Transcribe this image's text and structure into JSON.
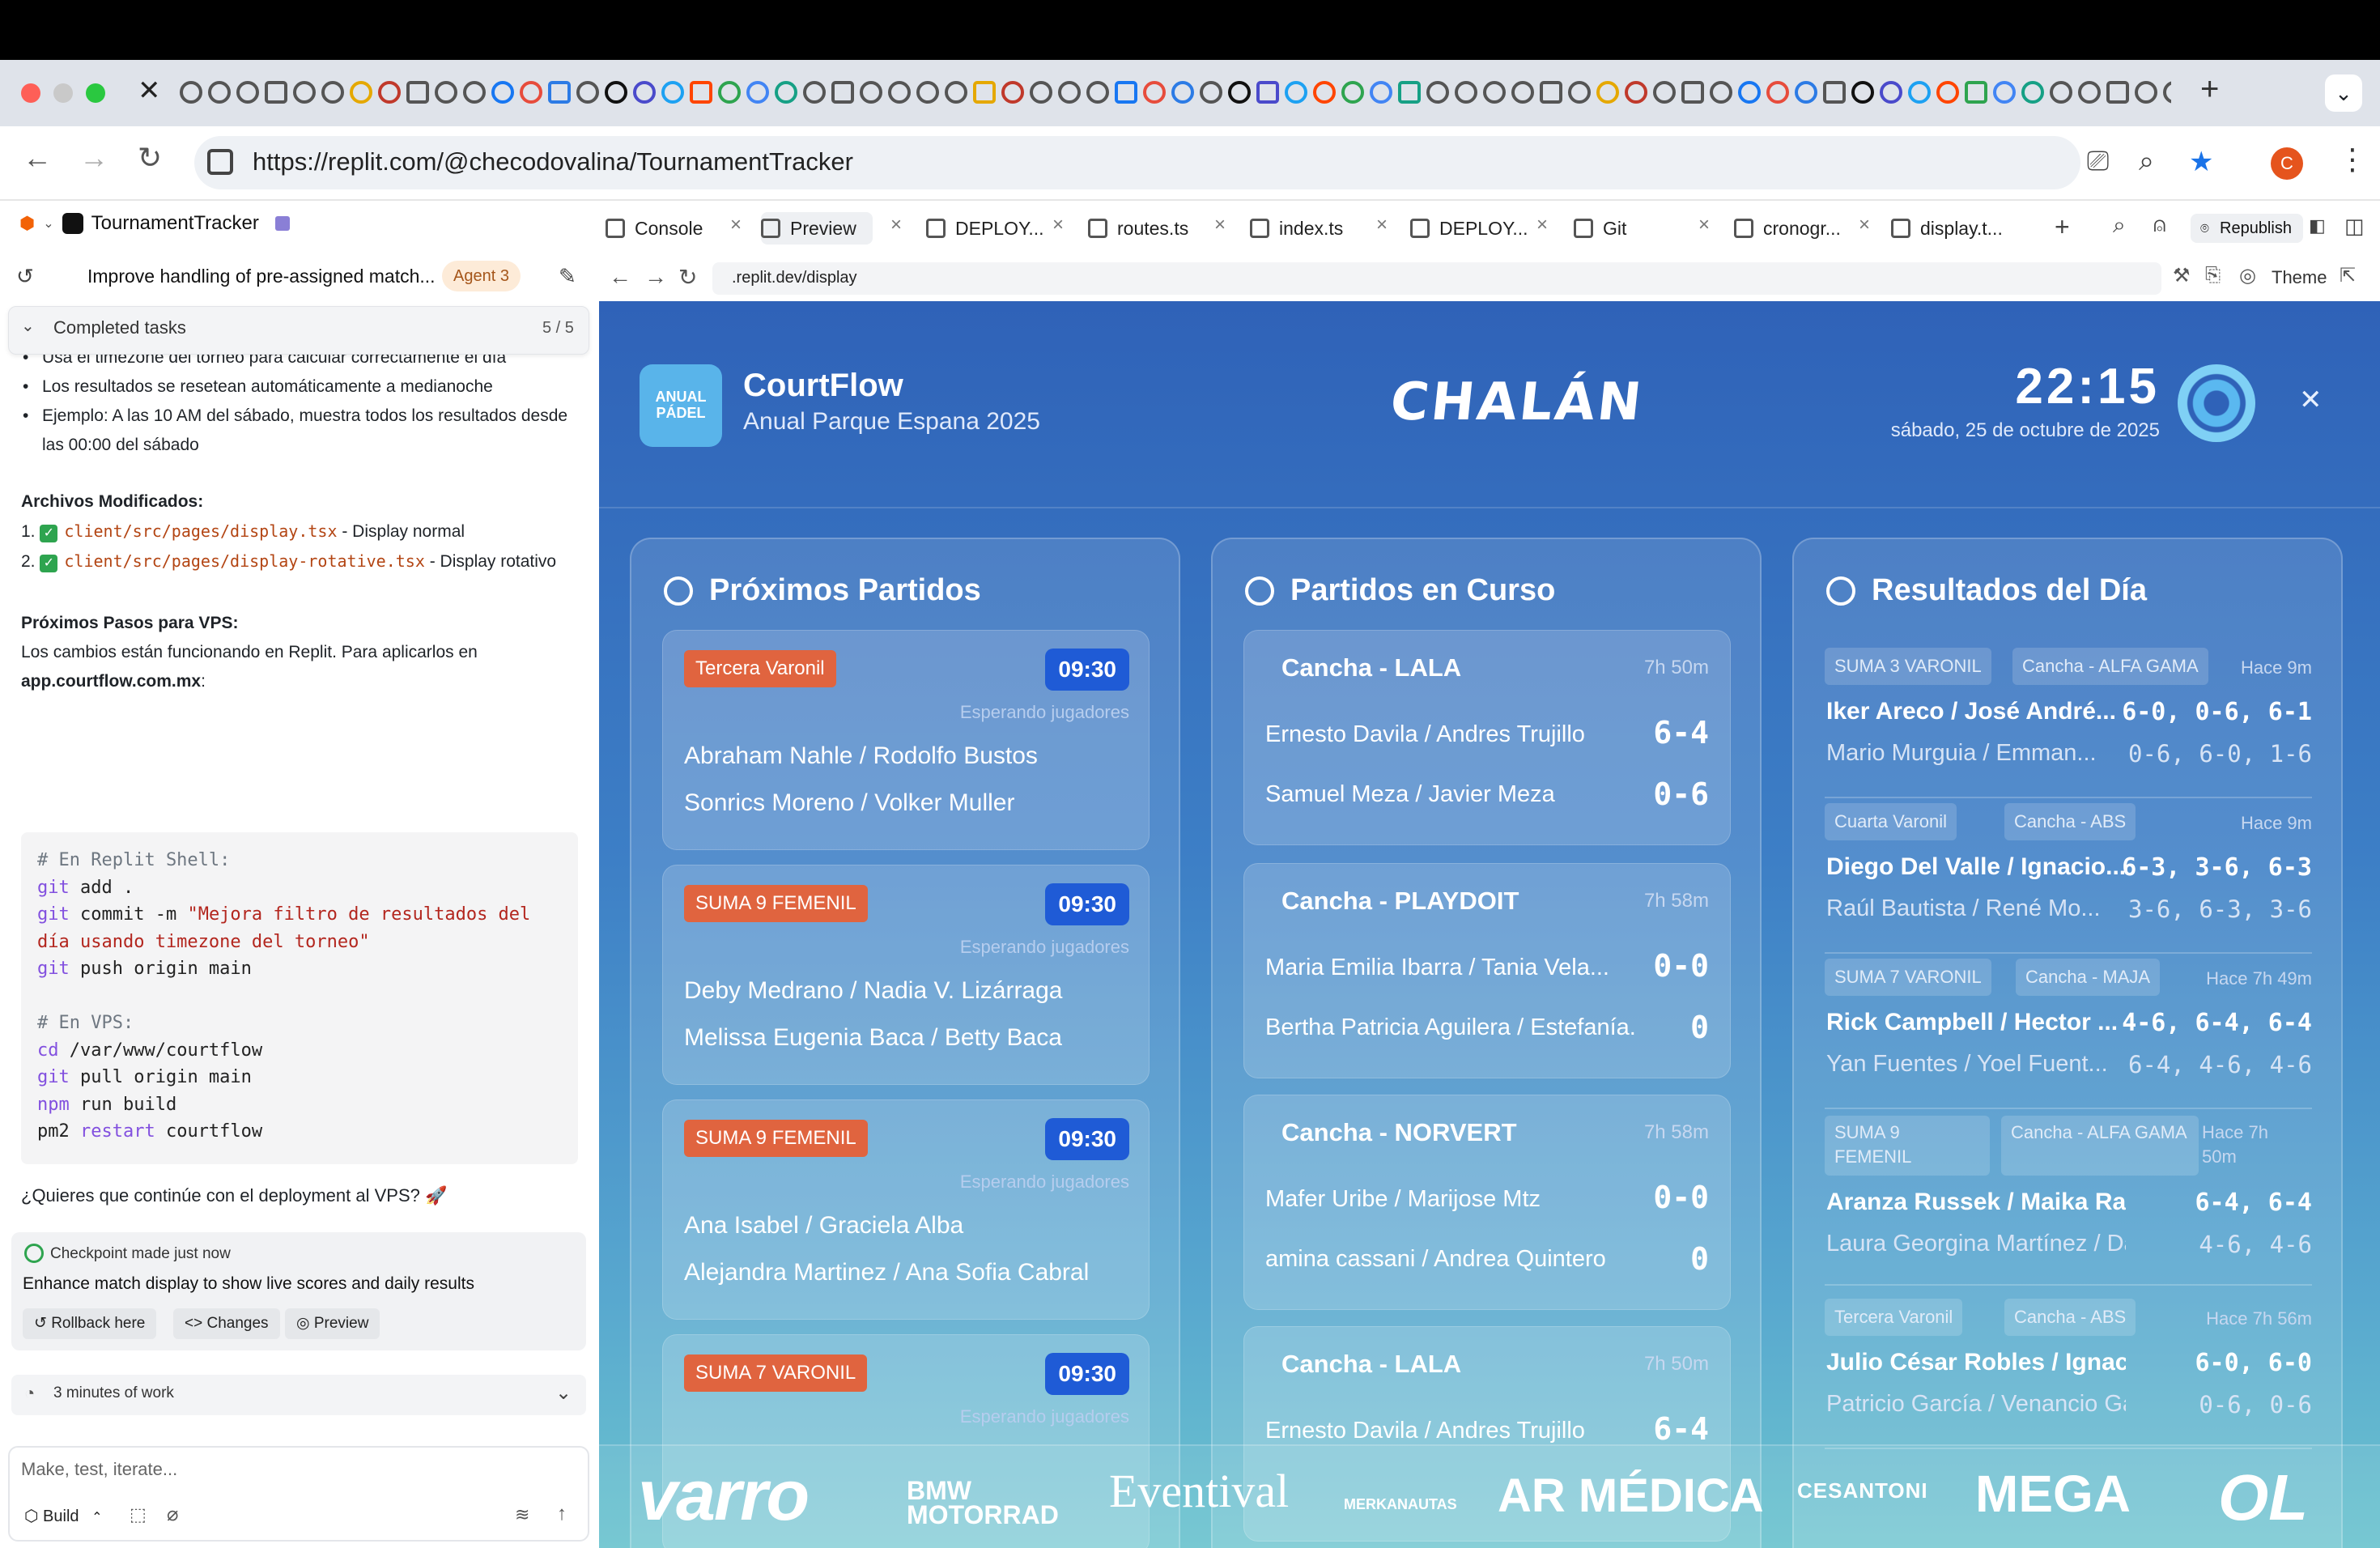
{
  "browser": {
    "url": "https://replit.com/@checodovalina/TournamentTracker",
    "avatar_initial": "C"
  },
  "left": {
    "project_name": "TournamentTracker",
    "chat_title": "Improve handling of pre-assigned match...",
    "agent_badge": "Agent 3",
    "completed_label": "Completed tasks",
    "completed_count": "5 / 5",
    "bullets": [
      "Usa el timezone del torneo para calcular correctamente el día",
      "Los resultados se resetean automáticamente a medianoche",
      "Ejemplo: A las 10 AM del sábado, muestra todos los resultados desde las 00:00 del sábado"
    ],
    "files_heading": "Archivos Modificados:",
    "files": [
      {
        "num": "1.",
        "path": "client/src/pages/display.tsx",
        "desc": " - Display normal"
      },
      {
        "num": "2.",
        "path": "client/src/pages/display-rotative.tsx",
        "desc": " - Display rotativo"
      }
    ],
    "steps_heading": "Próximos Pasos para VPS:",
    "steps_text": "Los cambios están funcionando en Replit. Para aplicarlos en",
    "steps_domain": "app.courtflow.com.mx",
    "code_lines": [
      "# En Replit Shell:",
      "git add .",
      "git commit -m \"Mejora filtro de resultados del",
      "día usando timezone del torneo\"",
      "git push origin main",
      "",
      "# En VPS:",
      "cd /var/www/courtflow",
      "git pull origin main",
      "npm run build",
      "pm2 restart courtflow"
    ],
    "question": "¿Quieres que continúe con el deployment al VPS? 🚀",
    "checkpoint_head": "Checkpoint made just now",
    "checkpoint_body": "Enhance match display to show live scores and daily results",
    "btn_rollback": "Rollback here",
    "btn_changes": "Changes",
    "btn_preview": "Preview",
    "work_label": "3 minutes of work",
    "input_placeholder": "Make, test, iterate...",
    "build_label": "Build"
  },
  "tabs": [
    {
      "label": "Console"
    },
    {
      "label": "Preview"
    },
    {
      "label": "DEPLOY..."
    },
    {
      "label": "routes.ts"
    },
    {
      "label": "index.ts"
    },
    {
      "label": "DEPLOY..."
    },
    {
      "label": "Git"
    },
    {
      "label": "cronogr..."
    },
    {
      "label": "display.t..."
    }
  ],
  "republish_label": "Republish",
  "preview": {
    "url": ".replit.dev/display",
    "theme_label": "Theme"
  },
  "app": {
    "logo_text": "ANUAL PÁDEL",
    "brand_name": "CourtFlow",
    "brand_sub": "Anual Parque Espana 2025",
    "center_logo": "CHALÁN",
    "clock": "22:15",
    "date": "sábado, 25 de octubre de 2025",
    "col1_title": "Próximos Partidos",
    "col2_title": "Partidos en Curso",
    "col3_title": "Resultados del Día",
    "upcoming": [
      {
        "cat": "Tercera Varonil",
        "time": "09:30",
        "status": "Esperando jugadores",
        "p1": "Abraham Nahle / Rodolfo Bustos",
        "p2": "Sonrics Moreno / Volker Muller"
      },
      {
        "cat": "SUMA 9 FEMENIL",
        "time": "09:30",
        "status": "Esperando jugadores",
        "p1": "Deby Medrano / Nadia V. Lizárraga",
        "p2": "Melissa Eugenia Baca / Betty Baca"
      },
      {
        "cat": "SUMA 9 FEMENIL",
        "time": "09:30",
        "status": "Esperando jugadores",
        "p1": "Ana Isabel / Graciela Alba",
        "p2": "Alejandra Martinez / Ana Sofia Cabral"
      },
      {
        "cat": "SUMA 7 VARONIL",
        "time": "09:30",
        "status": "Esperando jugadores"
      }
    ],
    "live": [
      {
        "court": "Cancha - LALA",
        "dur": "7h 50m",
        "t1": "Ernesto Davila / Andres Trujillo",
        "s1": "6-4",
        "t2": "Samuel Meza / Javier Meza",
        "s2": "0-6"
      },
      {
        "court": "Cancha - PLAYDOIT",
        "dur": "7h 58m",
        "t1": "Maria Emilia Ibarra / Tania Vela...",
        "s1": "0-0",
        "t2": "Bertha Patricia Aguilera / Estefanía...",
        "s2": "0"
      },
      {
        "court": "Cancha - NORVERT",
        "dur": "7h 58m",
        "t1": "Mafer Uribe / Marijose Mtz",
        "s1": "0-0",
        "t2": "amina cassani / Andrea Quintero",
        "s2": "0"
      },
      {
        "court": "Cancha - LALA",
        "dur": "7h 50m",
        "t1": "Ernesto Davila / Andres Trujillo",
        "s1": "6-4"
      }
    ],
    "results": [
      {
        "cat": "SUMA 3 VARONIL",
        "court": "Cancha - ALFA GAMA",
        "ago": "Hace 9m",
        "w": "Iker Areco / José André...",
        "ws": "6-0, 0-6, 6-1",
        "l": "Mario Murguia / Emman...",
        "ls": "0-6, 6-0, 1-6"
      },
      {
        "cat": "Cuarta Varonil",
        "court": "Cancha - ABS",
        "ago": "Hace 9m",
        "w": "Diego Del Valle / Ignacio...",
        "ws": "6-3, 3-6, 6-3",
        "l": "Raúl Bautista / René Mo...",
        "ls": "3-6, 6-3, 3-6"
      },
      {
        "cat": "SUMA 7 VARONIL",
        "court": "Cancha - MAJA",
        "ago": "Hace 7h 49m",
        "w": "Rick Campbell / Hector ...",
        "ws": "4-6, 6-4, 6-4",
        "l": "Yan Fuentes / Yoel Fuent...",
        "ls": "6-4, 4-6, 4-6"
      },
      {
        "cat": "SUMA 9 FEMENIL",
        "court": "Cancha - ALFA GAMA",
        "ago": "Hace 7h 50m",
        "w": "Aranza Russek / Maika Ramos",
        "ws": "6-4, 6-4",
        "l": "Laura Georgina Martínez / Dam...",
        "ls": "4-6, 4-6"
      },
      {
        "cat": "Tercera Varonil",
        "court": "Cancha - ABS",
        "ago": "Hace 7h 56m",
        "w": "Julio César Robles / Ignacio Fl...",
        "ws": "6-0, 6-0",
        "l": "Patricio García / Venancio Garcia",
        "ls": "0-6, 0-6"
      }
    ],
    "sponsors": [
      "varro",
      "BMW MOTORRAD",
      "Eventival",
      "MERKANAUTAS",
      "AR MÉDICA",
      "CESANTONI",
      "MEGA",
      "OL"
    ]
  },
  "colors": {
    "app_blue": "#2f62b8",
    "category_tag": "#e0643f",
    "time_badge": "#1f5bd6"
  }
}
